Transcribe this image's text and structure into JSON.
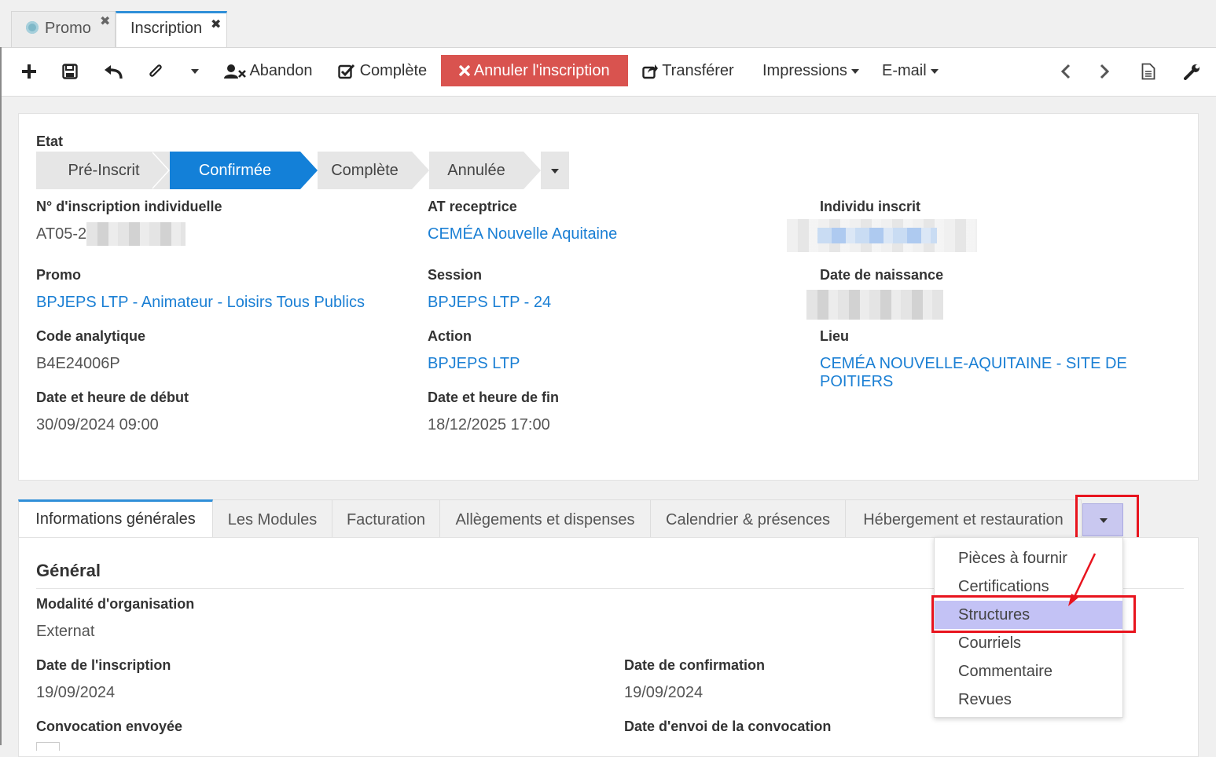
{
  "window_tabs": [
    {
      "label": "Promo",
      "icon": "gear-icon"
    },
    {
      "label": "Inscription",
      "icon": ""
    }
  ],
  "toolbar": {
    "abandon": "Abandon",
    "complete": "Complète",
    "cancel": "Annuler l'inscription",
    "transfer": "Transférer",
    "impressions": "Impressions",
    "email": "E-mail"
  },
  "state": {
    "label": "Etat",
    "steps": [
      "Pré-Inscrit",
      "Confirmée",
      "Complète",
      "Annulée"
    ],
    "active": "Confirmée"
  },
  "fields": {
    "num_label": "N° d'inscription individuelle",
    "num_value": "AT05-2",
    "at_label": "AT receptrice",
    "at_value": "CEMÉA Nouvelle Aquitaine",
    "individu_label": "Individu inscrit",
    "promo_label": "Promo",
    "promo_value": "BPJEPS LTP - Animateur - Loisirs Tous Publics",
    "session_label": "Session",
    "session_value": "BPJEPS LTP - 24",
    "birth_label": "Date de naissance",
    "code_label": "Code analytique",
    "code_value": "B4E24006P",
    "action_label": "Action",
    "action_value": "BPJEPS LTP",
    "lieu_label": "Lieu",
    "lieu_value": "CEMÉA NOUVELLE-AQUITAINE - SITE DE POITIERS",
    "start_label": "Date et heure de début",
    "start_value": "30/09/2024 09:00",
    "end_label": "Date et heure de fin",
    "end_value": "18/12/2025 17:00"
  },
  "content_tabs": [
    "Informations générales",
    "Les Modules",
    "Facturation",
    "Allègements et dispenses",
    "Calendrier & présences",
    "Hébergement et restauration"
  ],
  "general": {
    "title": "Général",
    "modalite_label": "Modalité d'organisation",
    "modalite_value": "Externat",
    "date_insc_label": "Date de l'inscription",
    "date_insc_value": "19/09/2024",
    "date_conf_label": "Date de confirmation",
    "date_conf_value": "19/09/2024",
    "convoc_label": "Convocation envoyée",
    "date_envoi_label": "Date d'envoi de la convocation"
  },
  "menu": {
    "items": [
      "Pièces à fournir",
      "Certifications",
      "Structures",
      "Courriels",
      "Commentaire",
      "Revues"
    ],
    "highlighted": "Structures"
  },
  "colors": {
    "accent": "#1380d8",
    "link": "#1a7fd4",
    "danger": "#d9534f",
    "highlight": "#c3c2f5",
    "annotation": "#e8141e"
  }
}
